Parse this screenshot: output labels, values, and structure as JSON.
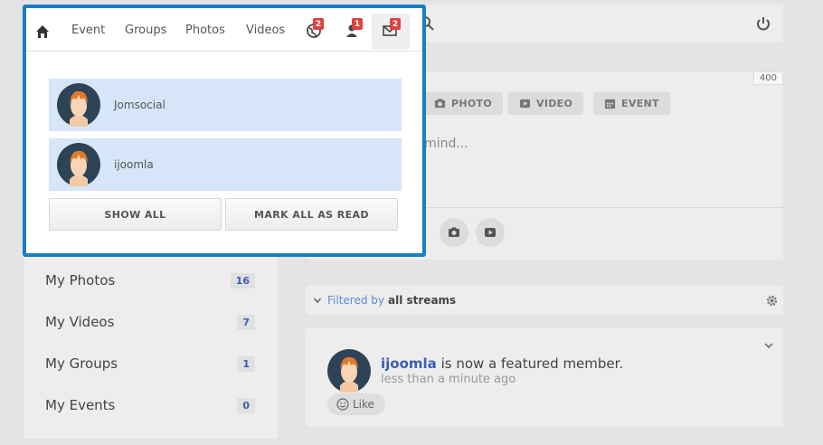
{
  "popup": {
    "nav": {
      "links": [
        "Event",
        "Groups",
        "Photos",
        "Videos"
      ],
      "badges": {
        "notifications": "2",
        "friend_requests": "1",
        "messages": "2"
      }
    },
    "notifications": [
      {
        "name": "Jomsocial"
      },
      {
        "name": "ijoomla"
      }
    ],
    "buttons": {
      "show_all": "SHOW ALL",
      "mark_all_read": "MARK ALL AS READ"
    }
  },
  "composer": {
    "char_count": "400",
    "chips": {
      "photo": "PHOTO",
      "video": "VIDEO",
      "event": "EVENT"
    },
    "placeholder_fragment": "ur mind..."
  },
  "filter": {
    "prefix": "Filtered by",
    "value": "all streams"
  },
  "activity": {
    "user": "ijoomla",
    "text": " is now a featured member.",
    "time": "less than a minute ago",
    "like_label": "Like"
  },
  "sidebar_menu": [
    {
      "label": "My Photos",
      "count": "16"
    },
    {
      "label": "My Videos",
      "count": "7"
    },
    {
      "label": "My Groups",
      "count": "1"
    },
    {
      "label": "My Events",
      "count": "0"
    }
  ],
  "colors": {
    "accent_border": "#1a7ec2",
    "badge_red": "#e04040",
    "highlight": "#d6e6f8",
    "link_blue": "#3b5db3"
  }
}
